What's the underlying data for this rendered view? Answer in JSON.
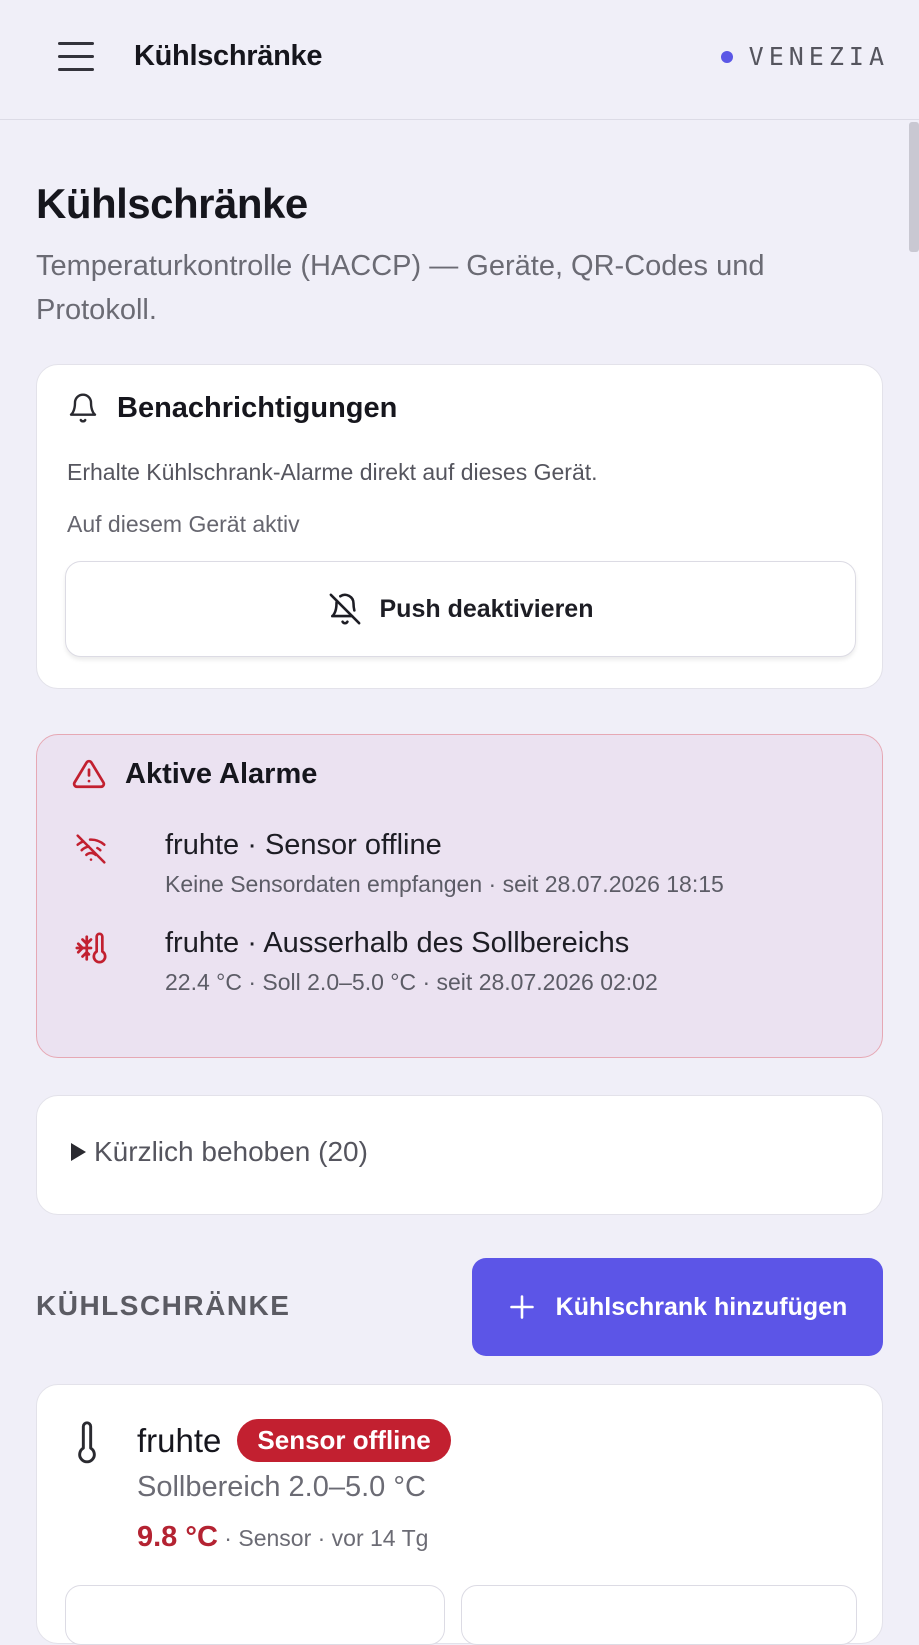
{
  "header": {
    "title": "Kühlschränke",
    "location": "VENEZIA",
    "menu_icon": "hamburger-menu-icon"
  },
  "page": {
    "title": "Kühlschränke",
    "subtitle": "Temperaturkontrolle (HACCP) — Geräte, QR-Codes und Protokoll."
  },
  "notifications": {
    "icon": "bell-icon",
    "title": "Benachrichtigungen",
    "description": "Erhalte Kühlschrank-Alarme direkt auf dieses Gerät.",
    "status": "Auf diesem Gerät aktiv",
    "button_icon": "bell-off-icon",
    "button_label": "Push deaktivieren"
  },
  "alarms": {
    "icon": "warning-triangle-icon",
    "title": "Aktive Alarme",
    "items": [
      {
        "icon": "wifi-off-icon",
        "device": "fruhte",
        "separator": " · ",
        "issue": "Sensor offline",
        "detail": "Keine Sensordaten empfangen · seit 28.07.2026 18:15"
      },
      {
        "icon": "thermometer-snowflake-icon",
        "device": "fruhte",
        "separator": " · ",
        "issue": "Ausserhalb des Sollbereichs",
        "detail": "22.4 °C · Soll 2.0–5.0 °C · seit 28.07.2026 02:02"
      }
    ]
  },
  "resolved": {
    "label": "Kürzlich behoben (20)"
  },
  "fridges": {
    "section_label": "KÜHLSCHRÄNKE",
    "add_button_label": "Kühlschrank hinzufügen",
    "items": [
      {
        "icon": "thermometer-icon",
        "name": "fruhte",
        "badge": "Sensor offline",
        "range": "Sollbereich 2.0–5.0 °C",
        "temperature": "9.8 °C",
        "reading_meta": " · Sensor · vor 14 Tg"
      }
    ]
  },
  "colors": {
    "accent": "#5c55e7",
    "alarm_red": "#c22030",
    "background": "#f0eff8"
  }
}
